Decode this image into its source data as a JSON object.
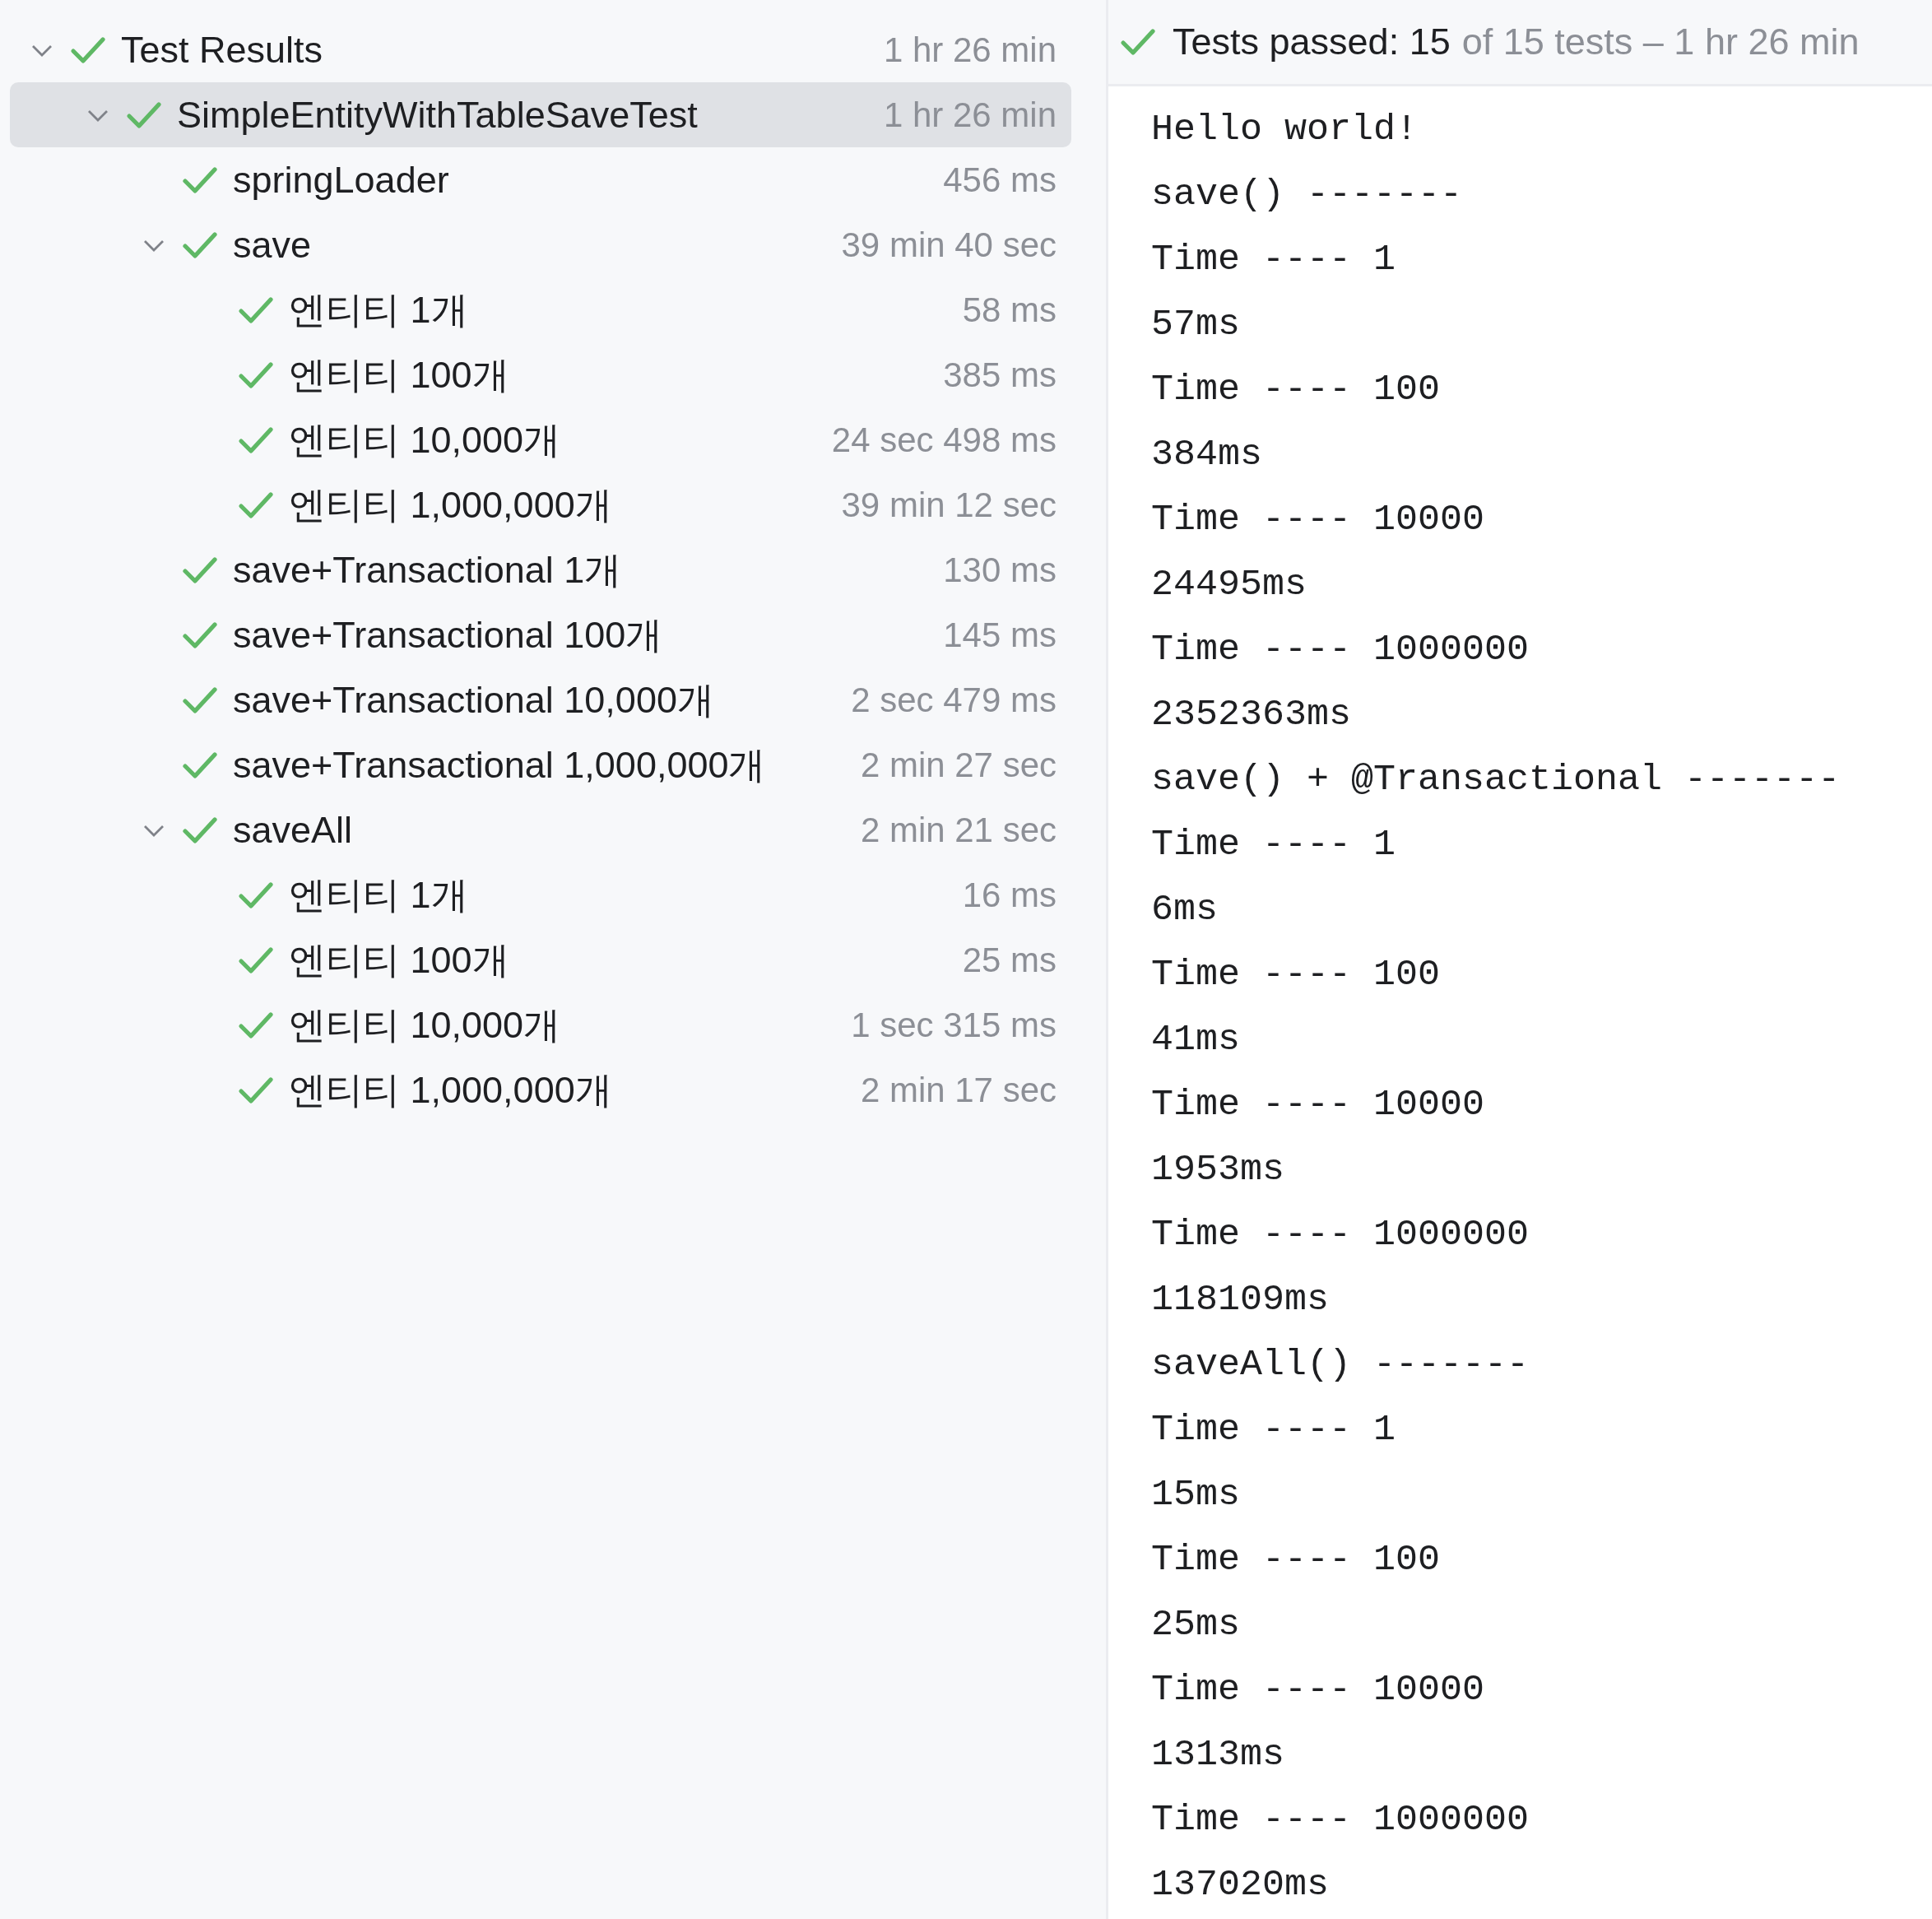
{
  "tree": [
    {
      "name": "Test Results",
      "time": "1 hr 26 min",
      "passed": true,
      "expanded": true,
      "selected": false,
      "children": [
        {
          "name": "SimpleEntityWithTableSaveTest",
          "time": "1 hr 26 min",
          "passed": true,
          "expanded": true,
          "selected": true,
          "children": [
            {
              "name": "springLoader",
              "time": "456 ms",
              "passed": true,
              "selected": false
            },
            {
              "name": "save",
              "time": "39 min 40 sec",
              "passed": true,
              "expanded": true,
              "selected": false,
              "children": [
                {
                  "name": "엔티티 1개",
                  "time": "58 ms",
                  "passed": true,
                  "selected": false
                },
                {
                  "name": "엔티티 100개",
                  "time": "385 ms",
                  "passed": true,
                  "selected": false
                },
                {
                  "name": "엔티티 10,000개",
                  "time": "24 sec 498 ms",
                  "passed": true,
                  "selected": false
                },
                {
                  "name": "엔티티 1,000,000개",
                  "time": "39 min 12 sec",
                  "passed": true,
                  "selected": false
                }
              ]
            },
            {
              "name": "save+Transactional 1개",
              "time": "130 ms",
              "passed": true,
              "selected": false
            },
            {
              "name": "save+Transactional 100개",
              "time": "145 ms",
              "passed": true,
              "selected": false
            },
            {
              "name": "save+Transactional 10,000개",
              "time": "2 sec 479 ms",
              "passed": true,
              "selected": false
            },
            {
              "name": "save+Transactional 1,000,000개",
              "time": "2 min 27 sec",
              "passed": true,
              "selected": false
            },
            {
              "name": "saveAll",
              "time": "2 min 21 sec",
              "passed": true,
              "expanded": true,
              "selected": false,
              "children": [
                {
                  "name": "엔티티 1개",
                  "time": "16 ms",
                  "passed": true,
                  "selected": false
                },
                {
                  "name": "엔티티 100개",
                  "time": "25 ms",
                  "passed": true,
                  "selected": false
                },
                {
                  "name": "엔티티 10,000개",
                  "time": "1 sec 315 ms",
                  "passed": true,
                  "selected": false
                },
                {
                  "name": "엔티티 1,000,000개",
                  "time": "2 min 17 sec",
                  "passed": true,
                  "selected": false
                }
              ]
            }
          ]
        }
      ]
    }
  ],
  "summary": {
    "passed": true,
    "label": "Tests passed: 15",
    "detail": "of 15 tests – 1 hr 26 min"
  },
  "console": [
    "Hello world!",
    "save() -------",
    "Time ---- 1",
    "57ms",
    "Time ---- 100",
    "384ms",
    "Time ---- 10000",
    "24495ms",
    "Time ---- 1000000",
    "2352363ms",
    "save() + @Transactional -------",
    "Time ---- 1",
    "6ms",
    "Time ---- 100",
    "41ms",
    "Time ---- 10000",
    "1953ms",
    "Time ---- 1000000",
    "118109ms",
    "saveAll() -------",
    "Time ---- 1",
    "15ms",
    "Time ---- 100",
    "25ms",
    "Time ---- 10000",
    "1313ms",
    "Time ---- 1000000",
    "137020ms"
  ]
}
